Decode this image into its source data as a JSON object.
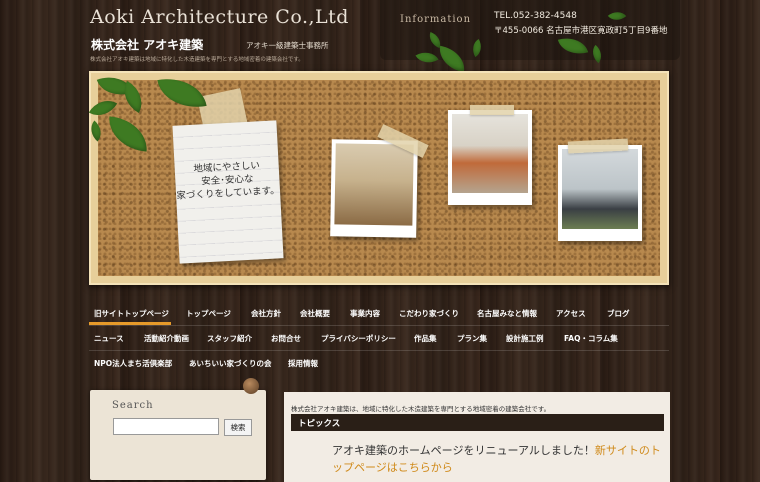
{
  "header": {
    "site_title": "Aoki Architecture Co.,Ltd",
    "company_name": "株式会社 アオキ建築",
    "company_sub": "アオキ一級建築士事務所",
    "tagline": "株式会社アオキ建築は地域に特化した木造建築を専門とする地域密着の建築会社です。",
    "info_label": "Information",
    "tel": "TEL.052-382-4548",
    "address": "〒455-0066 名古屋市港区寛政町5丁目9番地"
  },
  "hero": {
    "note_text": "地域にやさしい\n安全･安心な\n家づくりをしています。"
  },
  "nav": {
    "row1": [
      "旧サイトトップページ",
      "トップページ",
      "会社方針",
      "会社概要",
      "事業内容",
      "こだわり家づくり",
      "名古屋みなと情報",
      "アクセス",
      "ブログ"
    ],
    "row2": [
      "ニュース",
      "活動紹介動画",
      "スタッフ紹介",
      "お問合せ",
      "プライバシーポリシー",
      "作品集",
      "プラン集",
      "設計施工例",
      "FAQ・コラム集"
    ],
    "row3": [
      "NPO法人まち活倶楽部",
      "あいちいい家づくりの会",
      "採用情報"
    ]
  },
  "sidebar": {
    "search_title": "Search",
    "search_value": "",
    "search_button": "検索"
  },
  "main": {
    "intro": "株式会社アオキ建築は、地域に特化した木造建築を専門とする地域密着の建築会社です。",
    "topics_title": "トピックス",
    "news_text": "アオキ建築のホームページをリニューアルしました！",
    "news_link": "新サイトのトップページはこちらから"
  }
}
